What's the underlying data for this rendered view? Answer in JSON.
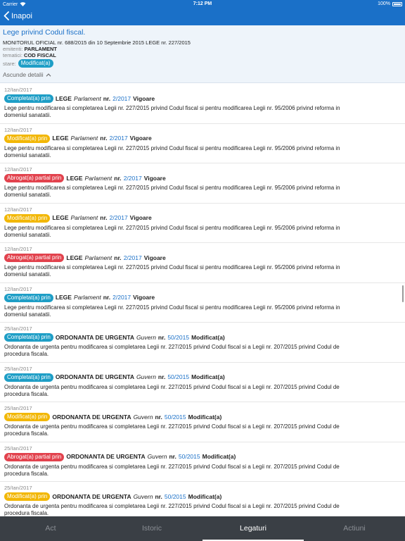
{
  "status": {
    "carrier": "Carrier",
    "time": "7:12 PM",
    "battery": "100%"
  },
  "nav": {
    "back_label": "Inapoi"
  },
  "header": {
    "title": "Lege privind Codul fiscal.",
    "publication": "MONITORUL OFICIAL nr. 688/2015 din 10 Septembrie 2015 LEGE nr. 227/2015",
    "emitent_label": "emitenti:",
    "emitent_value": "PARLAMENT",
    "tematica_label": "tematici:",
    "tematica_value": "COD FISCAL",
    "stare_label": "stare:",
    "stare_value": "Modificat(a)",
    "hide_details": "Ascunde detalii"
  },
  "items": [
    {
      "date": "12/Ian/2017",
      "badge": "Completat(a) prin",
      "kind": "completat",
      "tip": "LEGE",
      "emitent": "Parlament",
      "nr_label": "nr.",
      "number": "2/2017",
      "stare": "Vigoare",
      "desc": "Lege pentru modificarea si completarea Legii nr. 227/2015 privind Codul fiscal si pentru modificarea Legii nr. 95/2006 privind reforma in domeniul sanatatii."
    },
    {
      "date": "12/Ian/2017",
      "badge": "Modificat(a) prin",
      "kind": "modificat",
      "tip": "LEGE",
      "emitent": "Parlament",
      "nr_label": "nr.",
      "number": "2/2017",
      "stare": "Vigoare",
      "desc": "Lege pentru modificarea si completarea Legii nr. 227/2015 privind Codul fiscal si pentru modificarea Legii nr. 95/2006 privind reforma in domeniul sanatatii."
    },
    {
      "date": "12/Ian/2017",
      "badge": "Abrogat(a) partial prin",
      "kind": "abrogat",
      "tip": "LEGE",
      "emitent": "Parlament",
      "nr_label": "nr.",
      "number": "2/2017",
      "stare": "Vigoare",
      "desc": "Lege pentru modificarea si completarea Legii nr. 227/2015 privind Codul fiscal si pentru modificarea Legii nr. 95/2006 privind reforma in domeniul sanatatii."
    },
    {
      "date": "12/Ian/2017",
      "badge": "Modificat(a) prin",
      "kind": "modificat",
      "tip": "LEGE",
      "emitent": "Parlament",
      "nr_label": "nr.",
      "number": "2/2017",
      "stare": "Vigoare",
      "desc": "Lege pentru modificarea si completarea Legii nr. 227/2015 privind Codul fiscal si pentru modificarea Legii nr. 95/2006 privind reforma in domeniul sanatatii."
    },
    {
      "date": "12/Ian/2017",
      "badge": "Abrogat(a) partial prin",
      "kind": "abrogat",
      "tip": "LEGE",
      "emitent": "Parlament",
      "nr_label": "nr.",
      "number": "2/2017",
      "stare": "Vigoare",
      "desc": "Lege pentru modificarea si completarea Legii nr. 227/2015 privind Codul fiscal si pentru modificarea Legii nr. 95/2006 privind reforma in domeniul sanatatii."
    },
    {
      "date": "12/Ian/2017",
      "badge": "Completat(a) prin",
      "kind": "completat",
      "tip": "LEGE",
      "emitent": "Parlament",
      "nr_label": "nr.",
      "number": "2/2017",
      "stare": "Vigoare",
      "desc": "Lege pentru modificarea si completarea Legii nr. 227/2015 privind Codul fiscal si pentru modificarea Legii nr. 95/2006 privind reforma in domeniul sanatatii."
    },
    {
      "date": "25/Ian/2017",
      "badge": "Completat(a) prin",
      "kind": "completat",
      "tip": "ORDONANTA DE URGENTA",
      "emitent": "Guvern",
      "nr_label": "nr.",
      "number": "50/2015",
      "stare": "Modificat(a)",
      "desc": "Ordonanta de urgenta pentru modificarea si completarea Legii nr. 227/2015 privind Codul fiscal si a Legii nr. 207/2015 privind Codul de procedura fiscala."
    },
    {
      "date": "25/Ian/2017",
      "badge": "Completat(a) prin",
      "kind": "completat",
      "tip": "ORDONANTA DE URGENTA",
      "emitent": "Guvern",
      "nr_label": "nr.",
      "number": "50/2015",
      "stare": "Modificat(a)",
      "desc": "Ordonanta de urgenta pentru modificarea si completarea Legii nr. 227/2015 privind Codul fiscal si a Legii nr. 207/2015 privind Codul de procedura fiscala."
    },
    {
      "date": "25/Ian/2017",
      "badge": "Modificat(a) prin",
      "kind": "modificat",
      "tip": "ORDONANTA DE URGENTA",
      "emitent": "Guvern",
      "nr_label": "nr.",
      "number": "50/2015",
      "stare": "Modificat(a)",
      "desc": "Ordonanta de urgenta pentru modificarea si completarea Legii nr. 227/2015 privind Codul fiscal si a Legii nr. 207/2015 privind Codul de procedura fiscala."
    },
    {
      "date": "25/Ian/2017",
      "badge": "Abrogat(a) partial prin",
      "kind": "abrogat",
      "tip": "ORDONANTA DE URGENTA",
      "emitent": "Guvern",
      "nr_label": "nr.",
      "number": "50/2015",
      "stare": "Modificat(a)",
      "desc": "Ordonanta de urgenta pentru modificarea si completarea Legii nr. 227/2015 privind Codul fiscal si a Legii nr. 207/2015 privind Codul de procedura fiscala."
    },
    {
      "date": "25/Ian/2017",
      "badge": "Modificat(a) prin",
      "kind": "modificat",
      "tip": "ORDONANTA DE URGENTA",
      "emitent": "Guvern",
      "nr_label": "nr.",
      "number": "50/2015",
      "stare": "Modificat(a)",
      "desc": "Ordonanta de urgenta pentru modificarea si completarea Legii nr. 227/2015 privind Codul fiscal si a Legii nr. 207/2015 privind Codul de procedura fiscala."
    }
  ],
  "tabs": [
    {
      "label": "Act",
      "active": false
    },
    {
      "label": "Istoric",
      "active": false
    },
    {
      "label": "Legaturi",
      "active": true
    },
    {
      "label": "Actiuni",
      "active": false
    }
  ],
  "colors": {
    "primary": "#1a70c8",
    "completat": "#1e9ec6",
    "modificat": "#f2b705",
    "abrogat": "#e2424d",
    "tabbar": "#3a3f45"
  },
  "icons": {
    "back": "chevron-left-icon",
    "collapse": "chevron-up-icon",
    "wifi": "wifi-icon",
    "battery": "battery-icon"
  }
}
